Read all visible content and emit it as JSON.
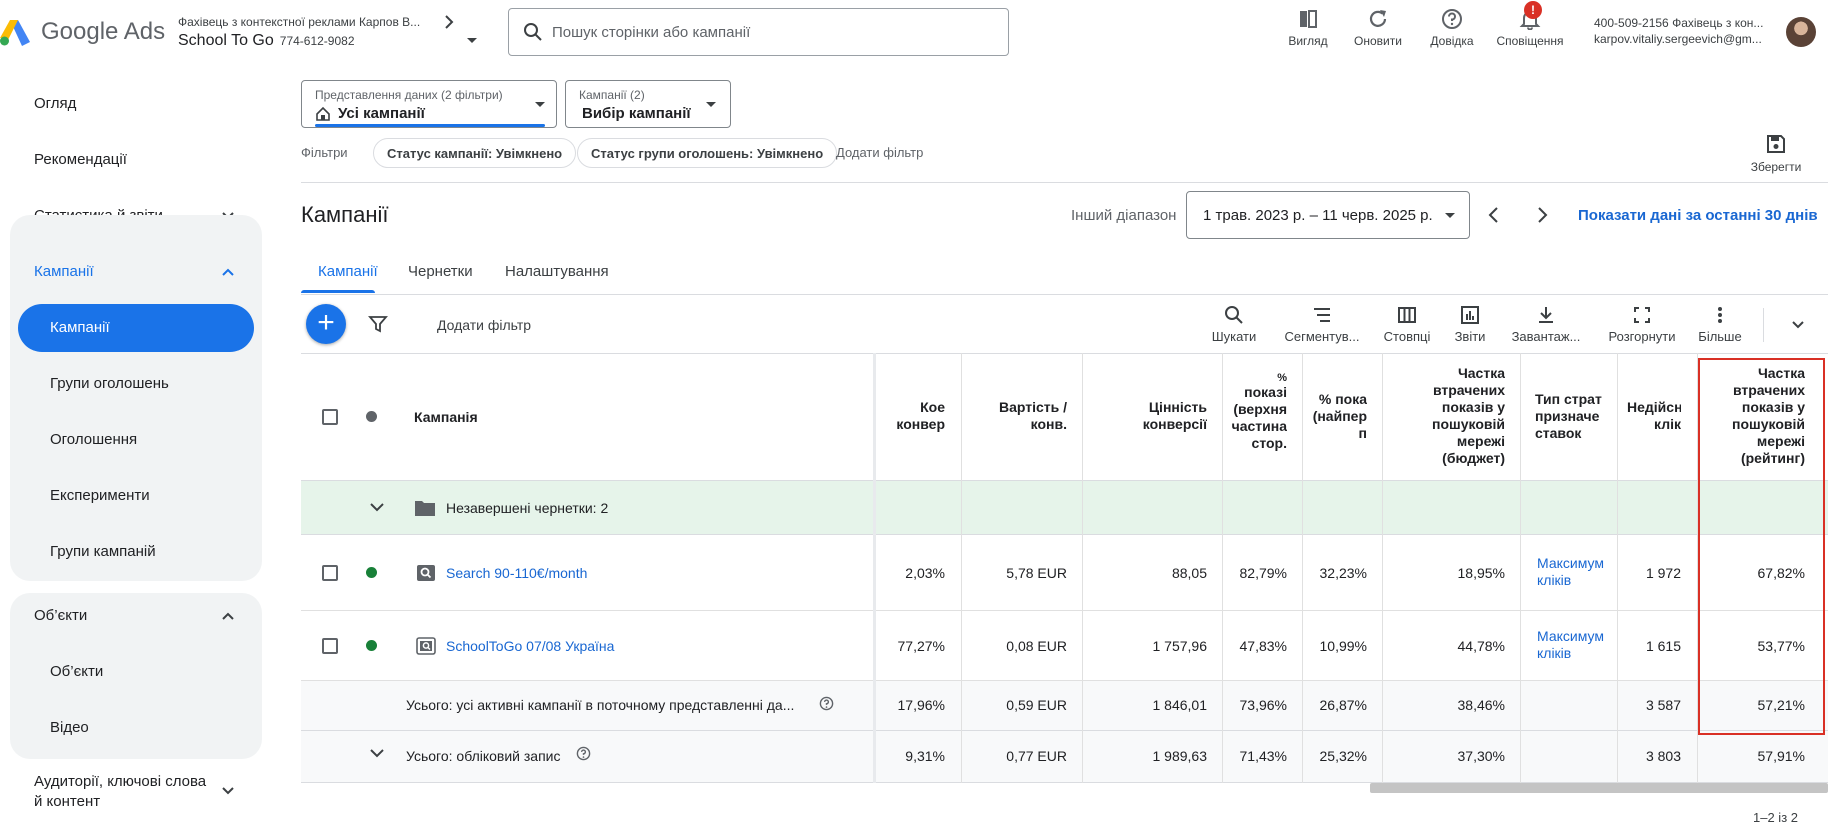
{
  "header": {
    "logo_text": "Google Ads",
    "account_subtitle": "Фахівець з контекстної реклами Карпов В...",
    "account_name": "School To Go",
    "account_id": "774-612-9082",
    "search_placeholder": "Пошук сторінки або кампанії",
    "actions": {
      "view": "Вигляд",
      "refresh": "Оновити",
      "help": "Довідка",
      "notifications": "Сповіщення",
      "notifications_badge": "!"
    },
    "user_line1": "400-509-2156 Фахівець з кон...",
    "user_line2": "karpov.vitaliy.sergeevich@gm..."
  },
  "sidebar": {
    "overview": "Огляд",
    "recommendations": "Рекомендації",
    "stats": "Статистика й звіти",
    "campaigns_section": "Кампанії",
    "campaigns_items": [
      "Кампанії",
      "Групи оголошень",
      "Оголошення",
      "Експерименти",
      "Групи кампаній"
    ],
    "objects_section": "Об’єкти",
    "objects_items": [
      "Об’єкти",
      "Відео"
    ],
    "audiences_line1": "Аудиторії, ключові слова",
    "audiences_line2": "й контент"
  },
  "view_selector": {
    "label": "Представлення даних (2 фільтри)",
    "value": "Усі кампанії"
  },
  "campaign_selector": {
    "label": "Кампанії (2)",
    "value": "Вибір кампанії"
  },
  "filters": {
    "label": "Фільтри",
    "chips": [
      "Статус кампанії: Увімкнено",
      "Статус групи оголошень: Увімкнено"
    ],
    "add": "Додати фільтр"
  },
  "save_label": "Зберегти",
  "page_title": "Кампанії",
  "date": {
    "label": "Інший діапазон",
    "range": "1 трав. 2023 р. – 11 черв. 2025 р.",
    "last30": "Показати дані за останні 30 днів"
  },
  "tabs": [
    "Кампанії",
    "Чернетки",
    "Налаштування"
  ],
  "table_toolbar": {
    "add_filter": "Додати фільтр",
    "search": "Шукати",
    "segment": "Сегментув...",
    "columns": "Стовпці",
    "reports": "Звіти",
    "download": "Завантаж...",
    "expand": "Розгорнути",
    "more": "Більше"
  },
  "table": {
    "headers": {
      "campaign": "Кампанія",
      "conv_rate": [
        "Кое",
        "конвер"
      ],
      "cost_conv": [
        "Вартість /",
        "конв."
      ],
      "conv_value": [
        "Цінність",
        "конверсії"
      ],
      "top_imp": [
        "%",
        "показі",
        "(верхня",
        "частина",
        "стор."
      ],
      "abs_top": [
        "% пока",
        "(найпер",
        "п"
      ],
      "lost_budget": [
        "Частка",
        "втрачених",
        "показів у",
        "пошуковій",
        "мережі",
        "(бюджет)"
      ],
      "bid_strategy": [
        "Тип страт",
        "призначе",
        "ставок"
      ],
      "invalid_clicks": [
        "Недійсн",
        "клік"
      ],
      "lost_rank": [
        "Частка",
        "втрачених",
        "показів у",
        "пошуковій",
        "мережі",
        "(рейтинг)"
      ]
    },
    "drafts_row": "Незавершені чернетки: 2",
    "rows": [
      {
        "status_color": "#188038",
        "name": "Search 90-110€/month",
        "conv_rate": "2,03%",
        "cost_conv": "5,78 EUR",
        "conv_value": "88,05",
        "top_imp": "82,79%",
        "abs_top": "32,23%",
        "lost_budget": "18,95%",
        "bid_strategy": [
          "Максимум",
          "кліків"
        ],
        "invalid_clicks": "1 972",
        "lost_rank": "67,82%"
      },
      {
        "status_color": "#188038",
        "name": "SchoolToGo 07/08 Україна",
        "conv_rate": "77,27%",
        "cost_conv": "0,08 EUR",
        "conv_value": "1 757,96",
        "top_imp": "47,83%",
        "abs_top": "10,99%",
        "lost_budget": "44,78%",
        "bid_strategy": [
          "Максимум",
          "кліків"
        ],
        "invalid_clicks": "1 615",
        "lost_rank": "53,77%"
      }
    ],
    "total_active": {
      "label": "Усього: усі активні кампанії в поточному представленні да...",
      "conv_rate": "17,96%",
      "cost_conv": "0,59 EUR",
      "conv_value": "1 846,01",
      "top_imp": "73,96%",
      "abs_top": "26,87%",
      "lost_budget": "38,46%",
      "invalid_clicks": "3 587",
      "lost_rank": "57,21%"
    },
    "total_account": {
      "label": "Усього: обліковий запис",
      "conv_rate": "9,31%",
      "cost_conv": "0,77 EUR",
      "conv_value": "1 989,63",
      "top_imp": "71,43%",
      "abs_top": "25,32%",
      "lost_budget": "37,30%",
      "invalid_clicks": "3 803",
      "lost_rank": "57,91%"
    }
  },
  "pagination": "1–2 із 2",
  "colors": {
    "accent": "#1a73e8",
    "highlight": "#d93025",
    "drafts_bg": "#e6f4ea",
    "total_bg": "#f8f9fa"
  }
}
